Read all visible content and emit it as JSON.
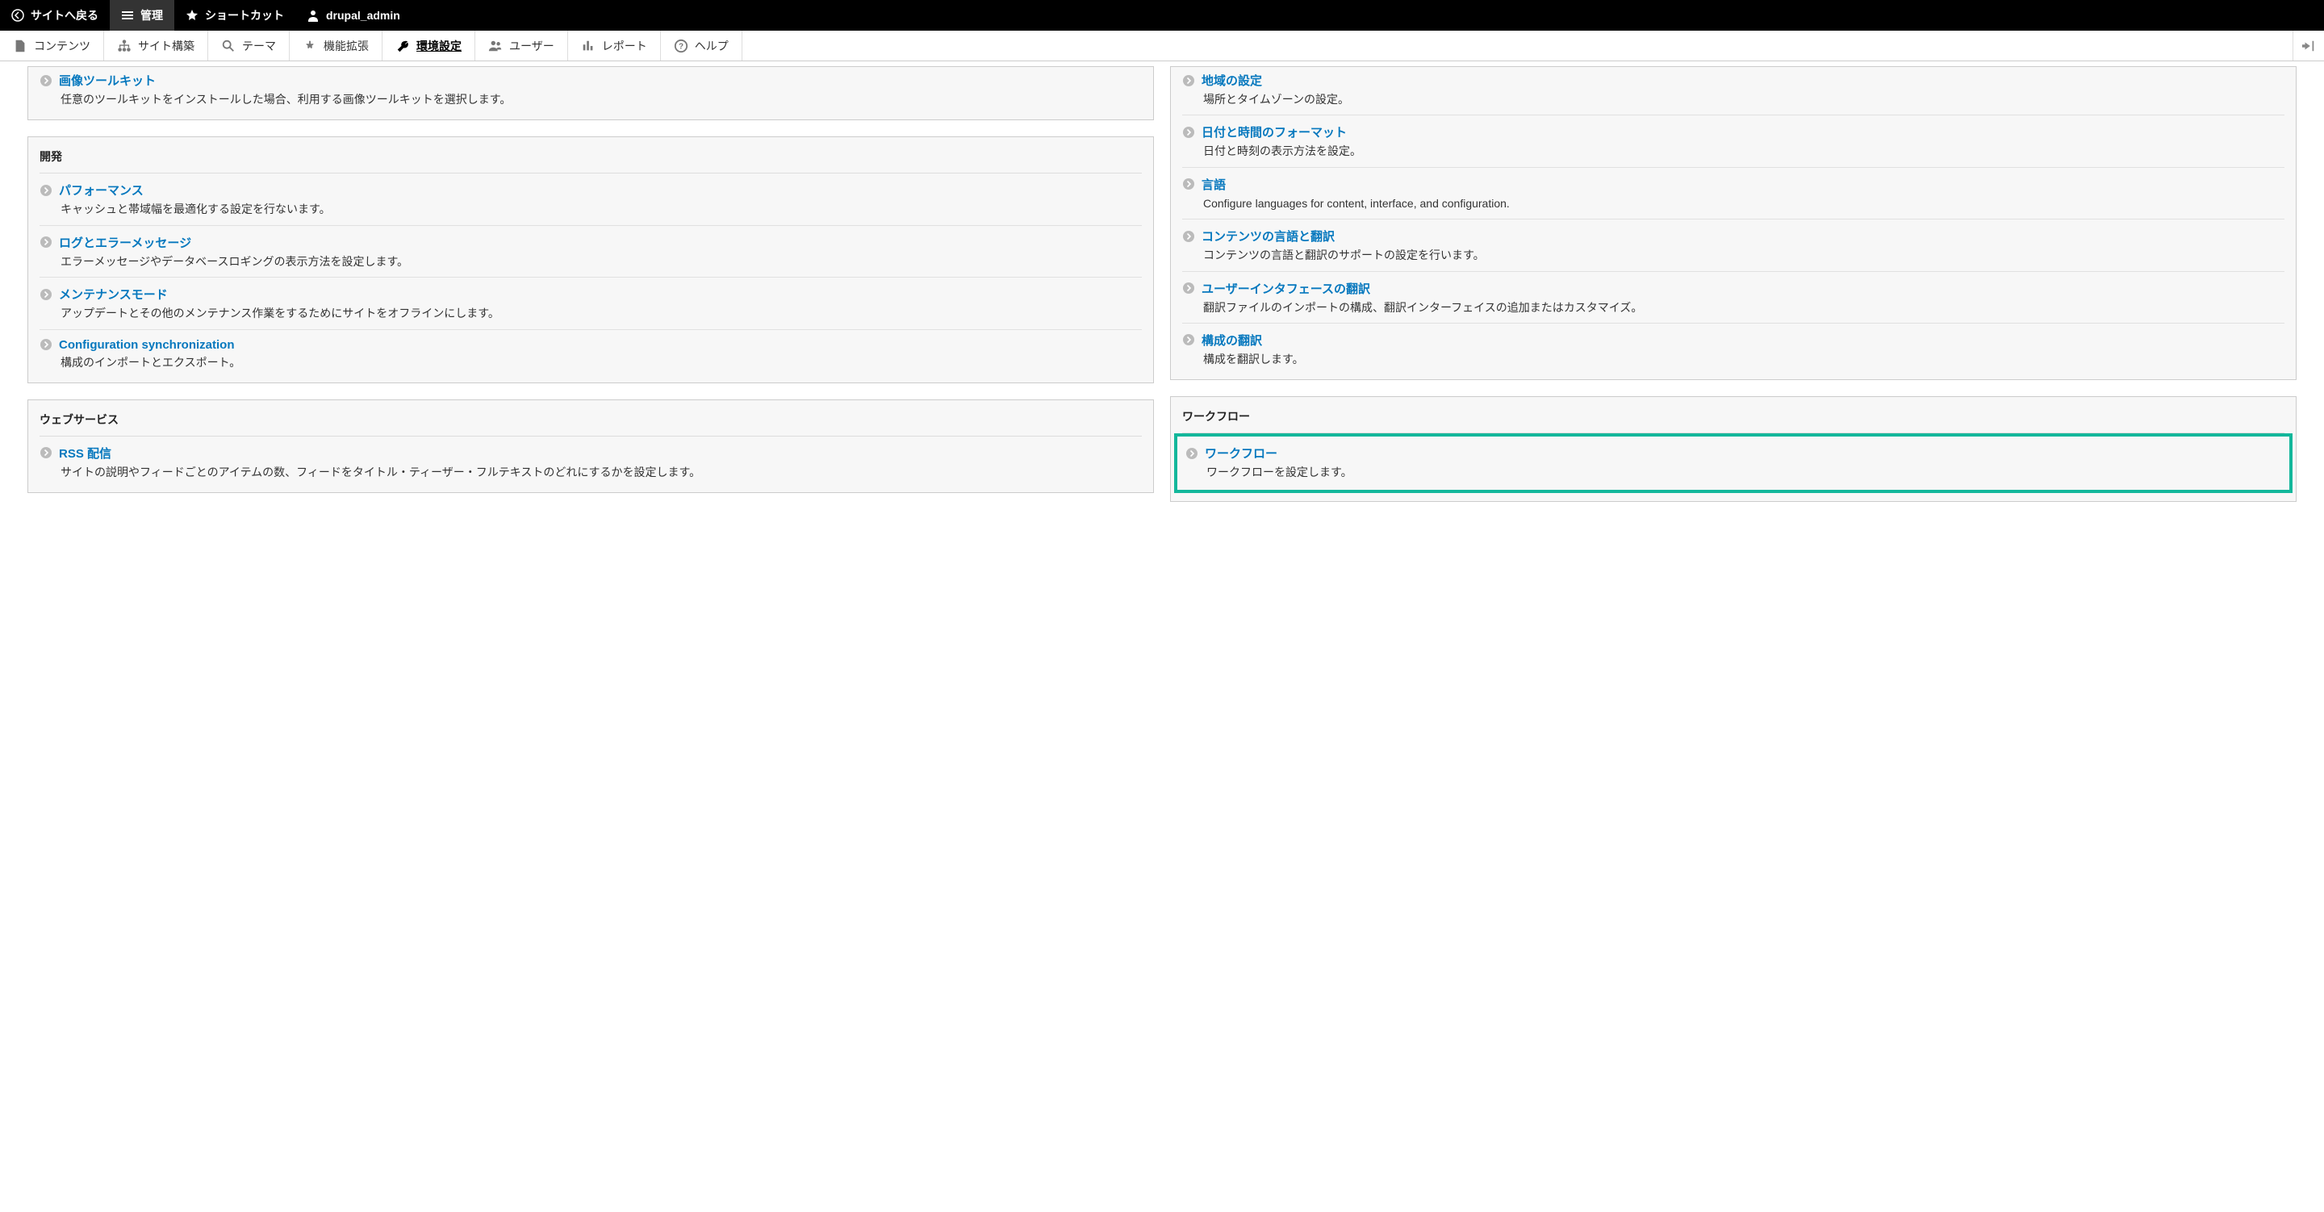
{
  "toolbar": {
    "back": "サイトへ戻る",
    "manage": "管理",
    "shortcuts": "ショートカット",
    "user": "drupal_admin"
  },
  "tabs": {
    "content": "コンテンツ",
    "structure": "サイト構築",
    "appearance": "テーマ",
    "extend": "機能拡張",
    "config": "環境設定",
    "people": "ユーザー",
    "reports": "レポート",
    "help": "ヘルプ"
  },
  "left": [
    {
      "header": null,
      "items": [
        {
          "title": "画像ツールキット",
          "desc": "任意のツールキットをインストールした場合、利用する画像ツールキットを選択します。"
        }
      ]
    },
    {
      "header": "開発",
      "items": [
        {
          "title": "パフォーマンス",
          "desc": "キャッシュと帯域幅を最適化する設定を行ないます。"
        },
        {
          "title": "ログとエラーメッセージ",
          "desc": "エラーメッセージやデータベースロギングの表示方法を設定します。"
        },
        {
          "title": "メンテナンスモード",
          "desc": "アップデートとその他のメンテナンス作業をするためにサイトをオフラインにします。"
        },
        {
          "title": "Configuration synchronization",
          "desc": "構成のインポートとエクスポート。"
        }
      ]
    },
    {
      "header": "ウェブサービス",
      "items": [
        {
          "title": "RSS 配信",
          "desc": "サイトの説明やフィードごとのアイテムの数、フィードをタイトル・ティーザー・フルテキストのどれにするかを設定します。"
        }
      ]
    }
  ],
  "right": [
    {
      "header": null,
      "items": [
        {
          "title": "地域の設定",
          "desc": "場所とタイムゾーンの設定。"
        },
        {
          "title": "日付と時間のフォーマット",
          "desc": "日付と時刻の表示方法を設定。"
        },
        {
          "title": "言語",
          "desc": "Configure languages for content, interface, and configuration."
        },
        {
          "title": "コンテンツの言語と翻訳",
          "desc": "コンテンツの言語と翻訳のサポートの設定を行います。"
        },
        {
          "title": "ユーザーインタフェースの翻訳",
          "desc": "翻訳ファイルのインポートの構成、翻訳インターフェイスの追加またはカスタマイズ。"
        },
        {
          "title": "構成の翻訳",
          "desc": "構成を翻訳します。"
        }
      ]
    },
    {
      "header": "ワークフロー",
      "highlight": true,
      "items": [
        {
          "title": "ワークフロー",
          "desc": "ワークフローを設定します。"
        }
      ]
    }
  ]
}
